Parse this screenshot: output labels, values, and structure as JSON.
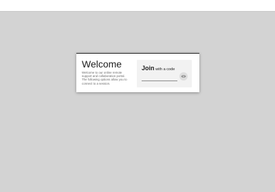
{
  "welcome": {
    "title": "Welcome",
    "description": "Welcome to our online remote\nsupport and collaboration portal.\nThe following options allow you to\nconnect to a session."
  },
  "join": {
    "heading_strong": "Join",
    "heading_rest": " with a code",
    "code_value": "",
    "code_placeholder": ""
  },
  "icons": {
    "reveal": "eye-icon"
  },
  "colors": {
    "background": "#d3d3d3",
    "panel": "#f2f2f2",
    "card": "#ffffff"
  }
}
